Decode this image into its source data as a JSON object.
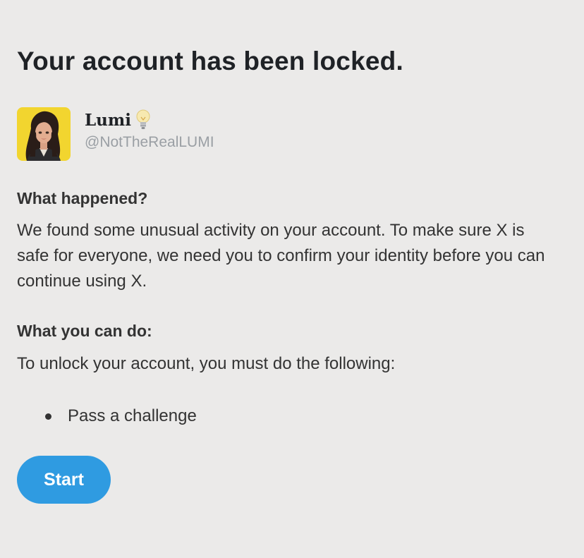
{
  "page": {
    "title": "Your account has been locked."
  },
  "profile": {
    "display_name": "Lumi",
    "display_name_icon": "lightbulb-icon",
    "handle": "@NotTheRealLUMI",
    "avatar": "avatar-image"
  },
  "what_happened": {
    "heading": "What happened?",
    "text": "We found some unusual activity on your account. To make sure X is safe for everyone, we need you to confirm your identity before you can continue using X."
  },
  "what_you_can_do": {
    "heading": "What you can do:",
    "text": "To unlock your account, you must do the following:",
    "steps": [
      {
        "label": "Pass a challenge"
      }
    ]
  },
  "actions": {
    "start_label": "Start"
  },
  "colors": {
    "background": "#ebeae9",
    "accent": "#2f9be1",
    "text": "#333333",
    "muted": "#9a9fa4"
  }
}
